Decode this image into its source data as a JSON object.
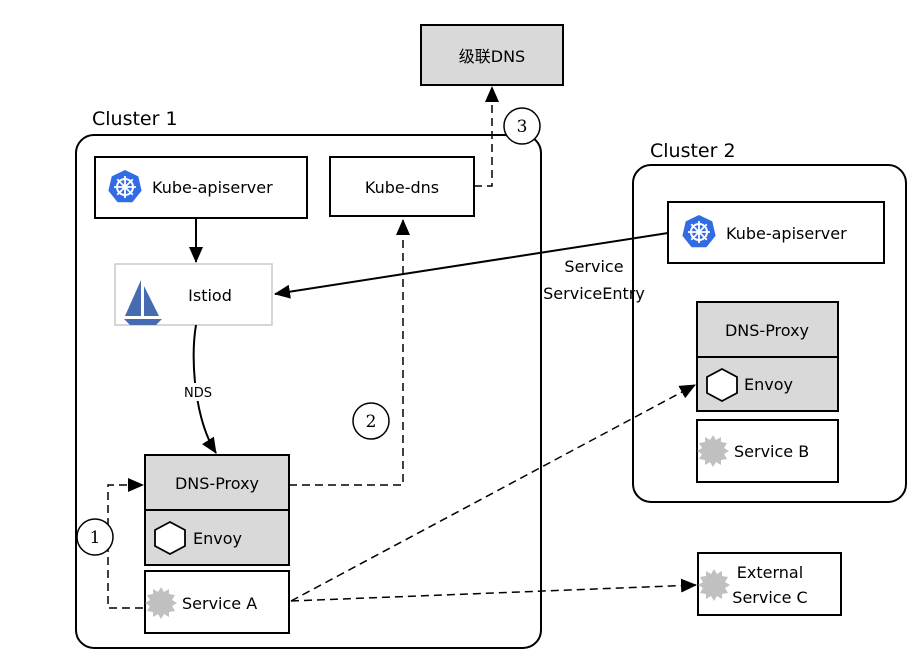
{
  "top_dns": {
    "label": "级联DNS"
  },
  "cluster1": {
    "title": "Cluster 1",
    "kube_apiserver": "Kube-apiserver",
    "kube_dns": "Kube-dns",
    "istiod": "Istiod",
    "nds_label": "NDS",
    "dns_proxy": "DNS-Proxy",
    "envoy": "Envoy",
    "service": "Service A"
  },
  "cluster2": {
    "title": "Cluster 2",
    "kube_apiserver": "Kube-apiserver",
    "dns_proxy": "DNS-Proxy",
    "envoy": "Envoy",
    "service": "Service B"
  },
  "external": {
    "line1": "External",
    "line2": "Service C"
  },
  "sync_labels": {
    "line1": "Service",
    "line2": "ServiceEntry"
  },
  "steps": [
    "1",
    "2",
    "3"
  ],
  "colors": {
    "gray_box": "#d9d9d9",
    "k8s_blue": "#326ce5",
    "istio_blue": "#466bb0",
    "service_gear": "#c0c0c0"
  }
}
